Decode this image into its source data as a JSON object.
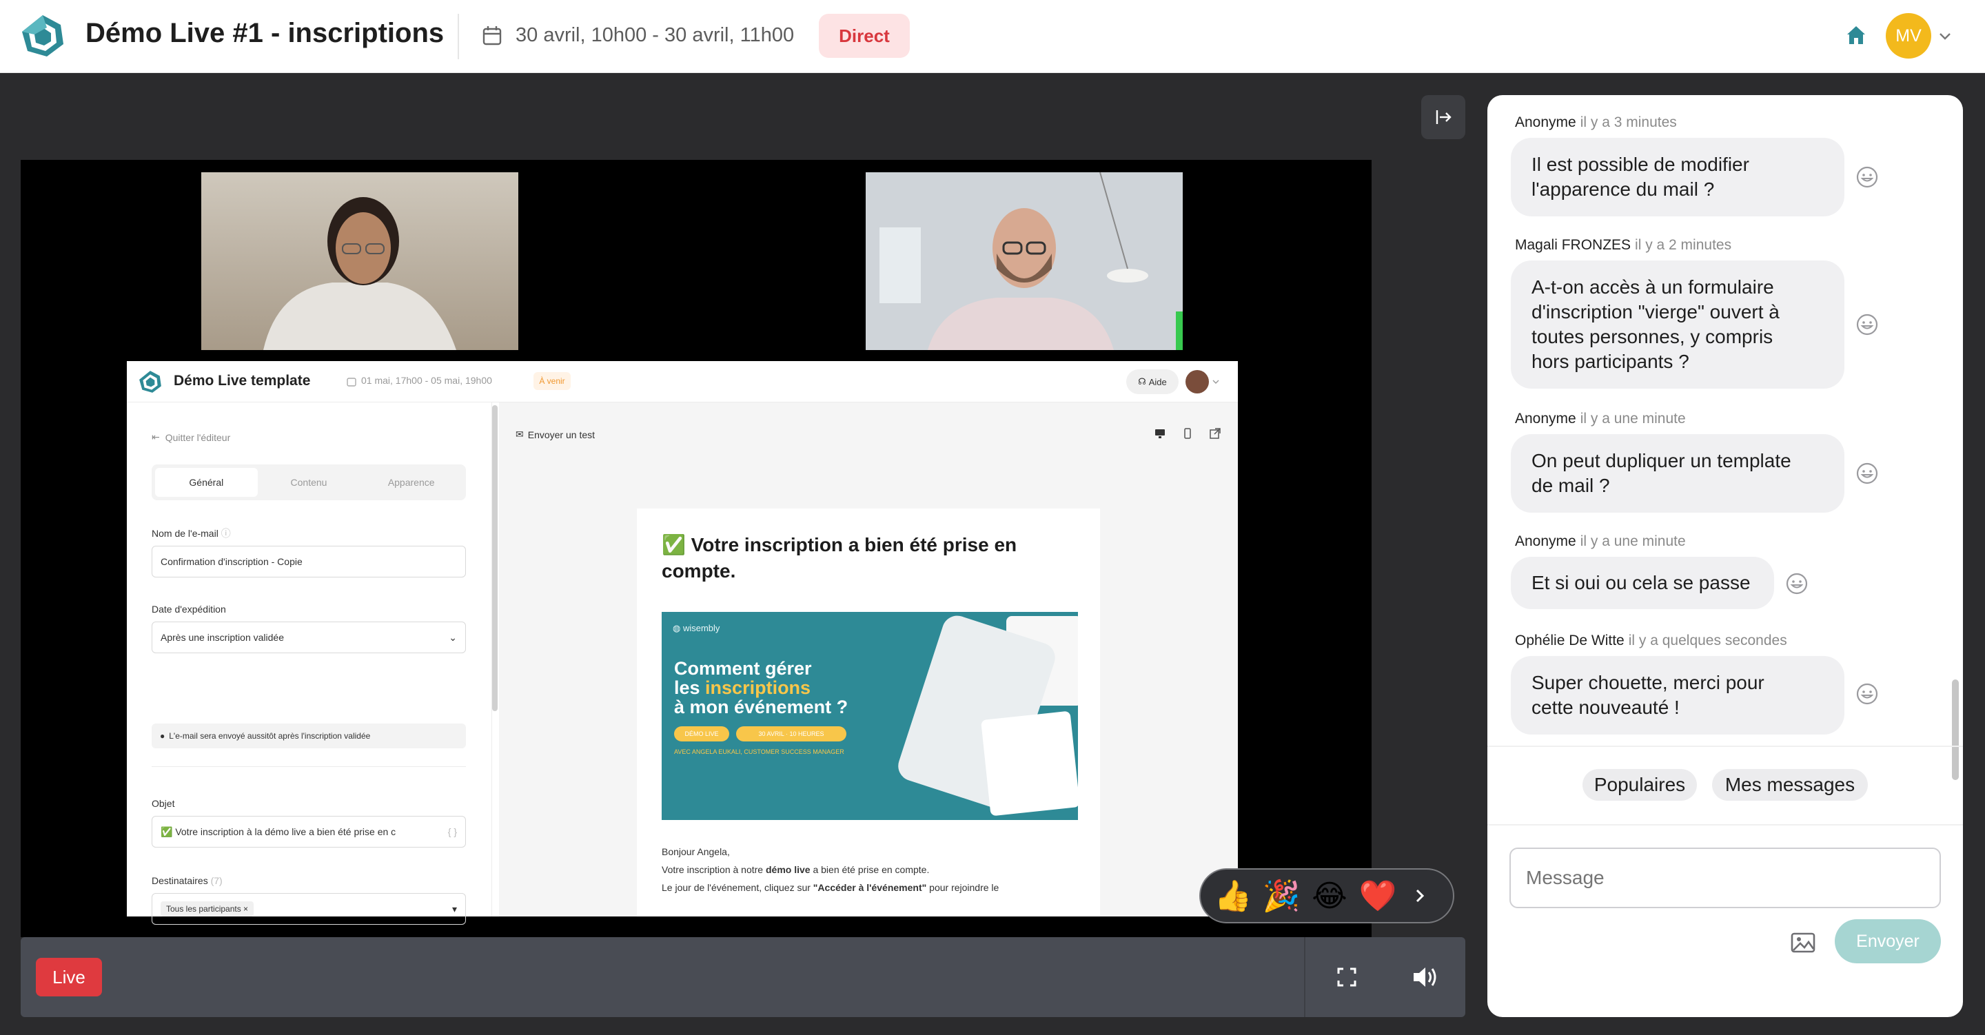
{
  "header": {
    "title": "Démo Live #1 - inscriptions",
    "date_range": "30 avril, 10h00 - 30 avril, 11h00",
    "status": "Direct",
    "user_initials": "MV"
  },
  "colors": {
    "accent": "#2e8a96",
    "live_red": "#df3a3f",
    "direct_badge_bg": "#fde3e4",
    "avatar_bg": "#f3b91c",
    "send_button": "#a6d5d2"
  },
  "shared_screen": {
    "app_title": "Démo Live template",
    "date_range": "01 mai, 17h00 - 05 mai, 19h00",
    "status": "À venir",
    "help_label": "Aide",
    "quit_label": "Quitter l'éditeur",
    "tabs": [
      "Général",
      "Contenu",
      "Apparence"
    ],
    "fields": {
      "email_name_label": "Nom de l'e-mail",
      "email_name_value": "Confirmation d'inscription - Copie",
      "send_date_label": "Date d'expédition",
      "send_date_value": "Après une inscription validée",
      "send_note": "L'e-mail sera envoyé aussitôt après l'inscription validée",
      "subject_label": "Objet",
      "subject_value": "✅ Votre inscription à la démo live a bien été prise en c",
      "recipients_label": "Destinataires",
      "recipients_count": "(7)",
      "recipients_chip": "Tous les participants ×"
    },
    "preview": {
      "send_test_label": "Envoyer un test",
      "email_heading": "✅ Votre inscription a bien été prise en compte.",
      "banner_brand": "wisembly",
      "banner_line1": "Comment gérer",
      "banner_line2_a": "les ",
      "banner_line2_b": "inscriptions",
      "banner_line3": "à mon événement ?",
      "banner_pill1": "DÉMO LIVE",
      "banner_pill2": "30 AVRIL · 10 HEURES",
      "banner_sub": "AVEC ANGELA EUKALI, CUSTOMER SUCCESS MANAGER",
      "greeting": "Bonjour Angela,",
      "body1_a": "Votre inscription à notre ",
      "body1_b": "démo live",
      "body1_c": " a bien été prise en compte.",
      "body2_a": "Le jour de l'événement, cliquez sur ",
      "body2_b": "\"Accéder à l'événement\"",
      "body2_c": " pour rejoindre le"
    }
  },
  "reactions": {
    "items": [
      "👍",
      "🎉",
      "😂",
      "❤️"
    ]
  },
  "controls": {
    "live_label": "Live"
  },
  "chat": {
    "messages": [
      {
        "author": "Anonyme",
        "time": "il y a 3 minutes",
        "text": [
          "Il est possible de modifier",
          "l'apparence du mail ?"
        ]
      },
      {
        "author": "Magali FRONZES",
        "time": "il y a 2 minutes",
        "text": [
          "A-t-on accès à un formulaire",
          "d'inscription \"vierge\" ouvert à",
          "toutes personnes, y compris",
          "hors participants ?"
        ]
      },
      {
        "author": "Anonyme",
        "time": "il y a une minute",
        "text": [
          "On peut dupliquer un template",
          "de mail ?"
        ]
      },
      {
        "author": "Anonyme",
        "time": "il y a une minute",
        "text": [
          "Et si oui ou cela se passe"
        ]
      },
      {
        "author": "Ophélie De Witte",
        "time": "il y a quelques secondes",
        "text": [
          "Super chouette, merci pour",
          "cette nouveauté !"
        ]
      }
    ],
    "filters": [
      "Populaires",
      "Mes messages"
    ],
    "input_placeholder": "Message",
    "send_label": "Envoyer"
  }
}
